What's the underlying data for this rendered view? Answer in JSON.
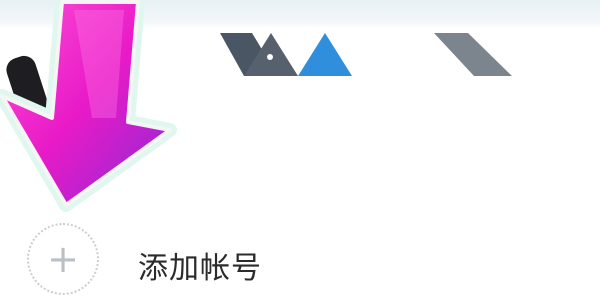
{
  "add_account": {
    "icon": "plus-icon",
    "icon_glyph": "+",
    "label": "添加帐号"
  },
  "overlay": {
    "arrow_icon": "down-left-arrow-icon",
    "arrow_color": "#e81ac7"
  }
}
